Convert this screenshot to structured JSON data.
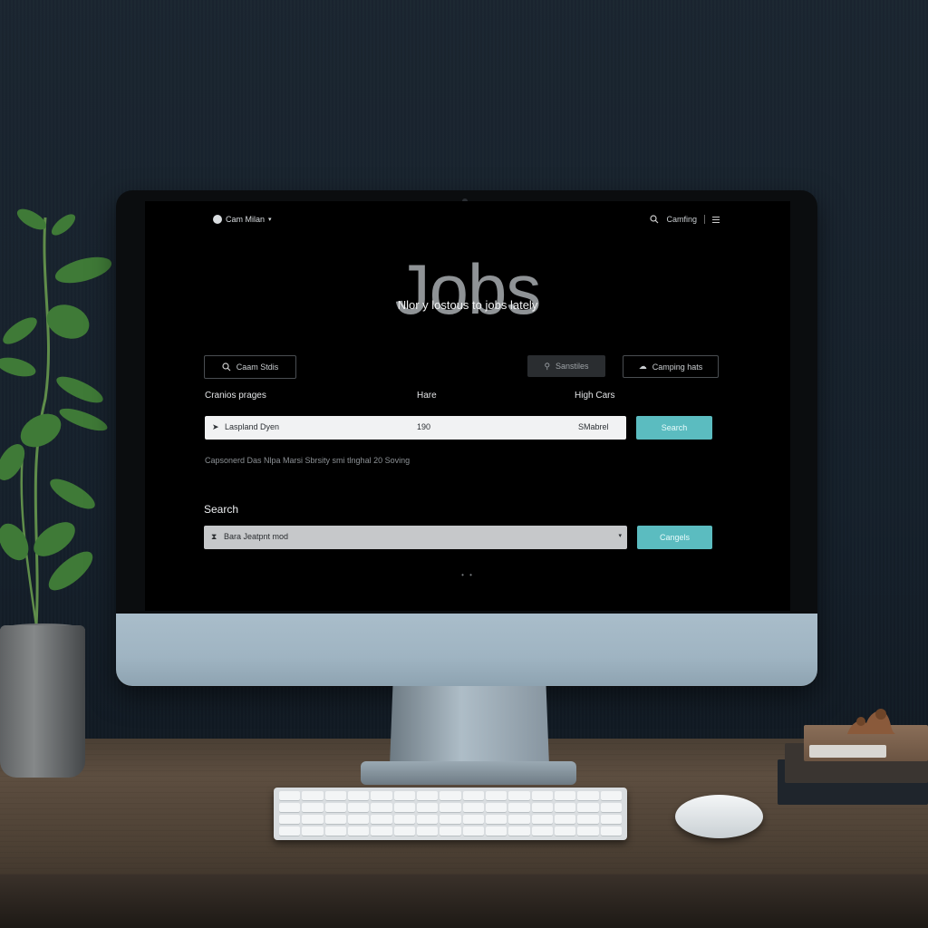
{
  "screen": {
    "brand": "Cam Milan",
    "topright_label": "Camfing",
    "title": "Jobs",
    "subtitle": "Nlor y lostous to jobs lately",
    "buttons": {
      "search_jobs": "Caam Stdis",
      "ghost": "Sanstiles",
      "outline": "Camping hats"
    },
    "columns": {
      "col1": "Cranios prages",
      "col2": "Hare",
      "col3": "High Cars"
    },
    "row": {
      "name": "Laspland Dyen",
      "value": "190",
      "amount": "SMabrel",
      "action": "Search"
    },
    "note": "Capsonerd Das Nlpa Marsi Sbrsity smi tlnghal 20 Soving",
    "search": {
      "label": "Search",
      "value": "Bara Jeatpnt mod",
      "action": "Cangels"
    },
    "pager": "• •"
  },
  "colors": {
    "accent": "#5bbcc0",
    "screen_bg": "#000000",
    "chin": "#a9bdca",
    "wall": "#1a2530"
  },
  "icons": [
    "brand-logo-icon",
    "chevron-down-icon",
    "search-icon",
    "menu-icon",
    "person-icon",
    "cloud-icon",
    "cursor-icon",
    "hourglass-icon"
  ]
}
